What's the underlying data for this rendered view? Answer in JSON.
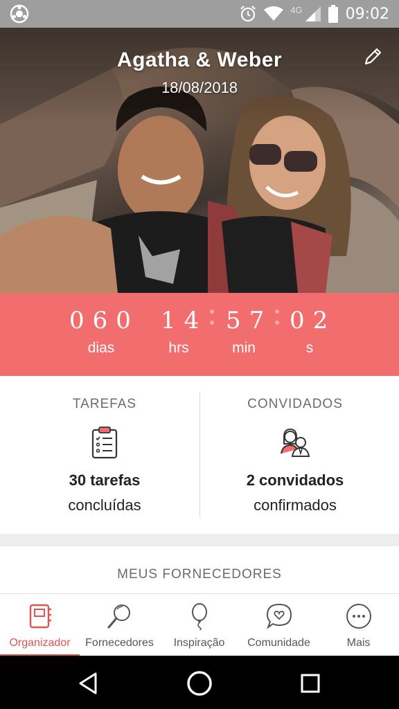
{
  "status_bar": {
    "time": "09:02",
    "network": "4G",
    "icons": [
      "app-notification-icon",
      "alarm-icon",
      "wifi-icon",
      "signal-icon",
      "battery-icon"
    ]
  },
  "hero": {
    "couple_names": "Agatha & Weber",
    "wedding_date": "18/08/2018",
    "edit_icon": "pencil-icon"
  },
  "countdown": {
    "days": "060",
    "hours": "14",
    "minutes": "57",
    "seconds": "02",
    "labels": {
      "days": "dias",
      "hours": "hrs",
      "minutes": "min",
      "seconds": "s"
    },
    "background": "#f26d6d"
  },
  "stats": {
    "tasks": {
      "heading": "TAREFAS",
      "count": "30 tarefas",
      "sub": "concluídas",
      "icon": "clipboard-checklist-icon"
    },
    "guests": {
      "heading": "CONVIDADOS",
      "count": "2 convidados",
      "sub": "confirmados",
      "icon": "couple-guests-icon"
    }
  },
  "vendors": {
    "heading": "MEUS FORNECEDORES"
  },
  "bottom_nav": {
    "active_color": "#e5534e",
    "items": [
      {
        "label": "Organizador",
        "icon": "planner-book-icon",
        "active": true
      },
      {
        "label": "Fornecedores",
        "icon": "magnifier-icon",
        "active": false
      },
      {
        "label": "Inspiração",
        "icon": "balloon-icon",
        "active": false
      },
      {
        "label": "Comunidade",
        "icon": "chat-heart-icon",
        "active": false
      },
      {
        "label": "Mais",
        "icon": "more-dots-icon",
        "active": false
      }
    ]
  },
  "system_nav": {
    "icons": [
      "back-icon",
      "home-icon",
      "recents-icon"
    ]
  }
}
